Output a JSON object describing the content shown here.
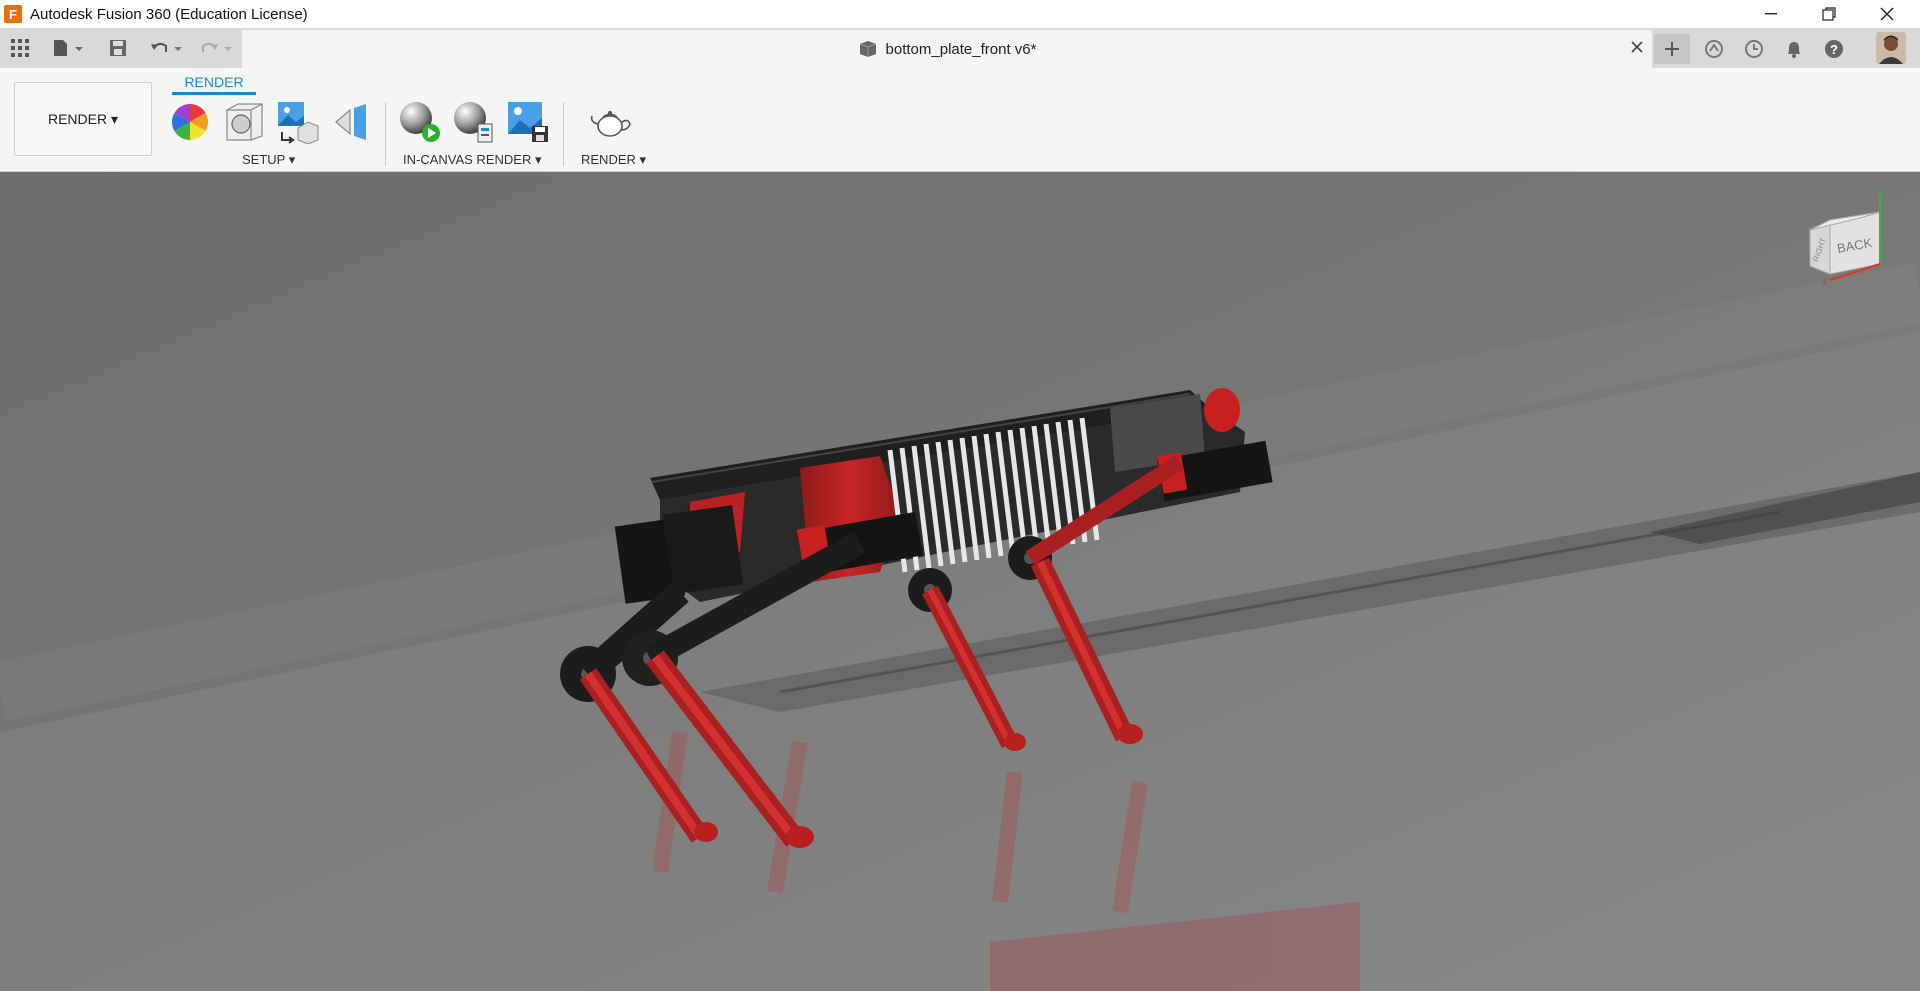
{
  "window": {
    "app_logo_letter": "F",
    "title": "Autodesk Fusion 360 (Education License)"
  },
  "document": {
    "tab_title": "bottom_plate_front v6*"
  },
  "ribbon": {
    "workspace_button": "RENDER ▾",
    "active_tab": "RENDER",
    "groups": [
      {
        "label": "SETUP ▾"
      },
      {
        "label": "IN-CANVAS RENDER ▾"
      },
      {
        "label": "RENDER ▾"
      }
    ]
  },
  "viewcube": {
    "face_back": "BACK",
    "face_right": "RIGHT",
    "axis_y": "Y",
    "axis_x": "X"
  },
  "colors": {
    "accent": "#1a8ad6",
    "model_red": "#d42626",
    "model_dark": "#1e1e1e"
  }
}
